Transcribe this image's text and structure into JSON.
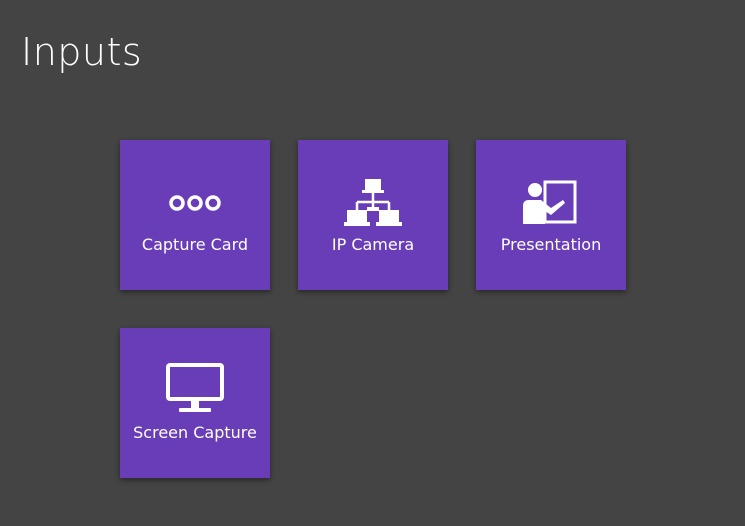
{
  "page": {
    "title": "Inputs",
    "background_color": "#444444",
    "tile_color": "#6a3db8"
  },
  "tiles": [
    {
      "label": "Capture Card",
      "icon": "ellipsis-icon"
    },
    {
      "label": "IP Camera",
      "icon": "network-icon"
    },
    {
      "label": "Presentation",
      "icon": "presenter-icon"
    },
    {
      "label": "Screen Capture",
      "icon": "monitor-icon"
    }
  ]
}
